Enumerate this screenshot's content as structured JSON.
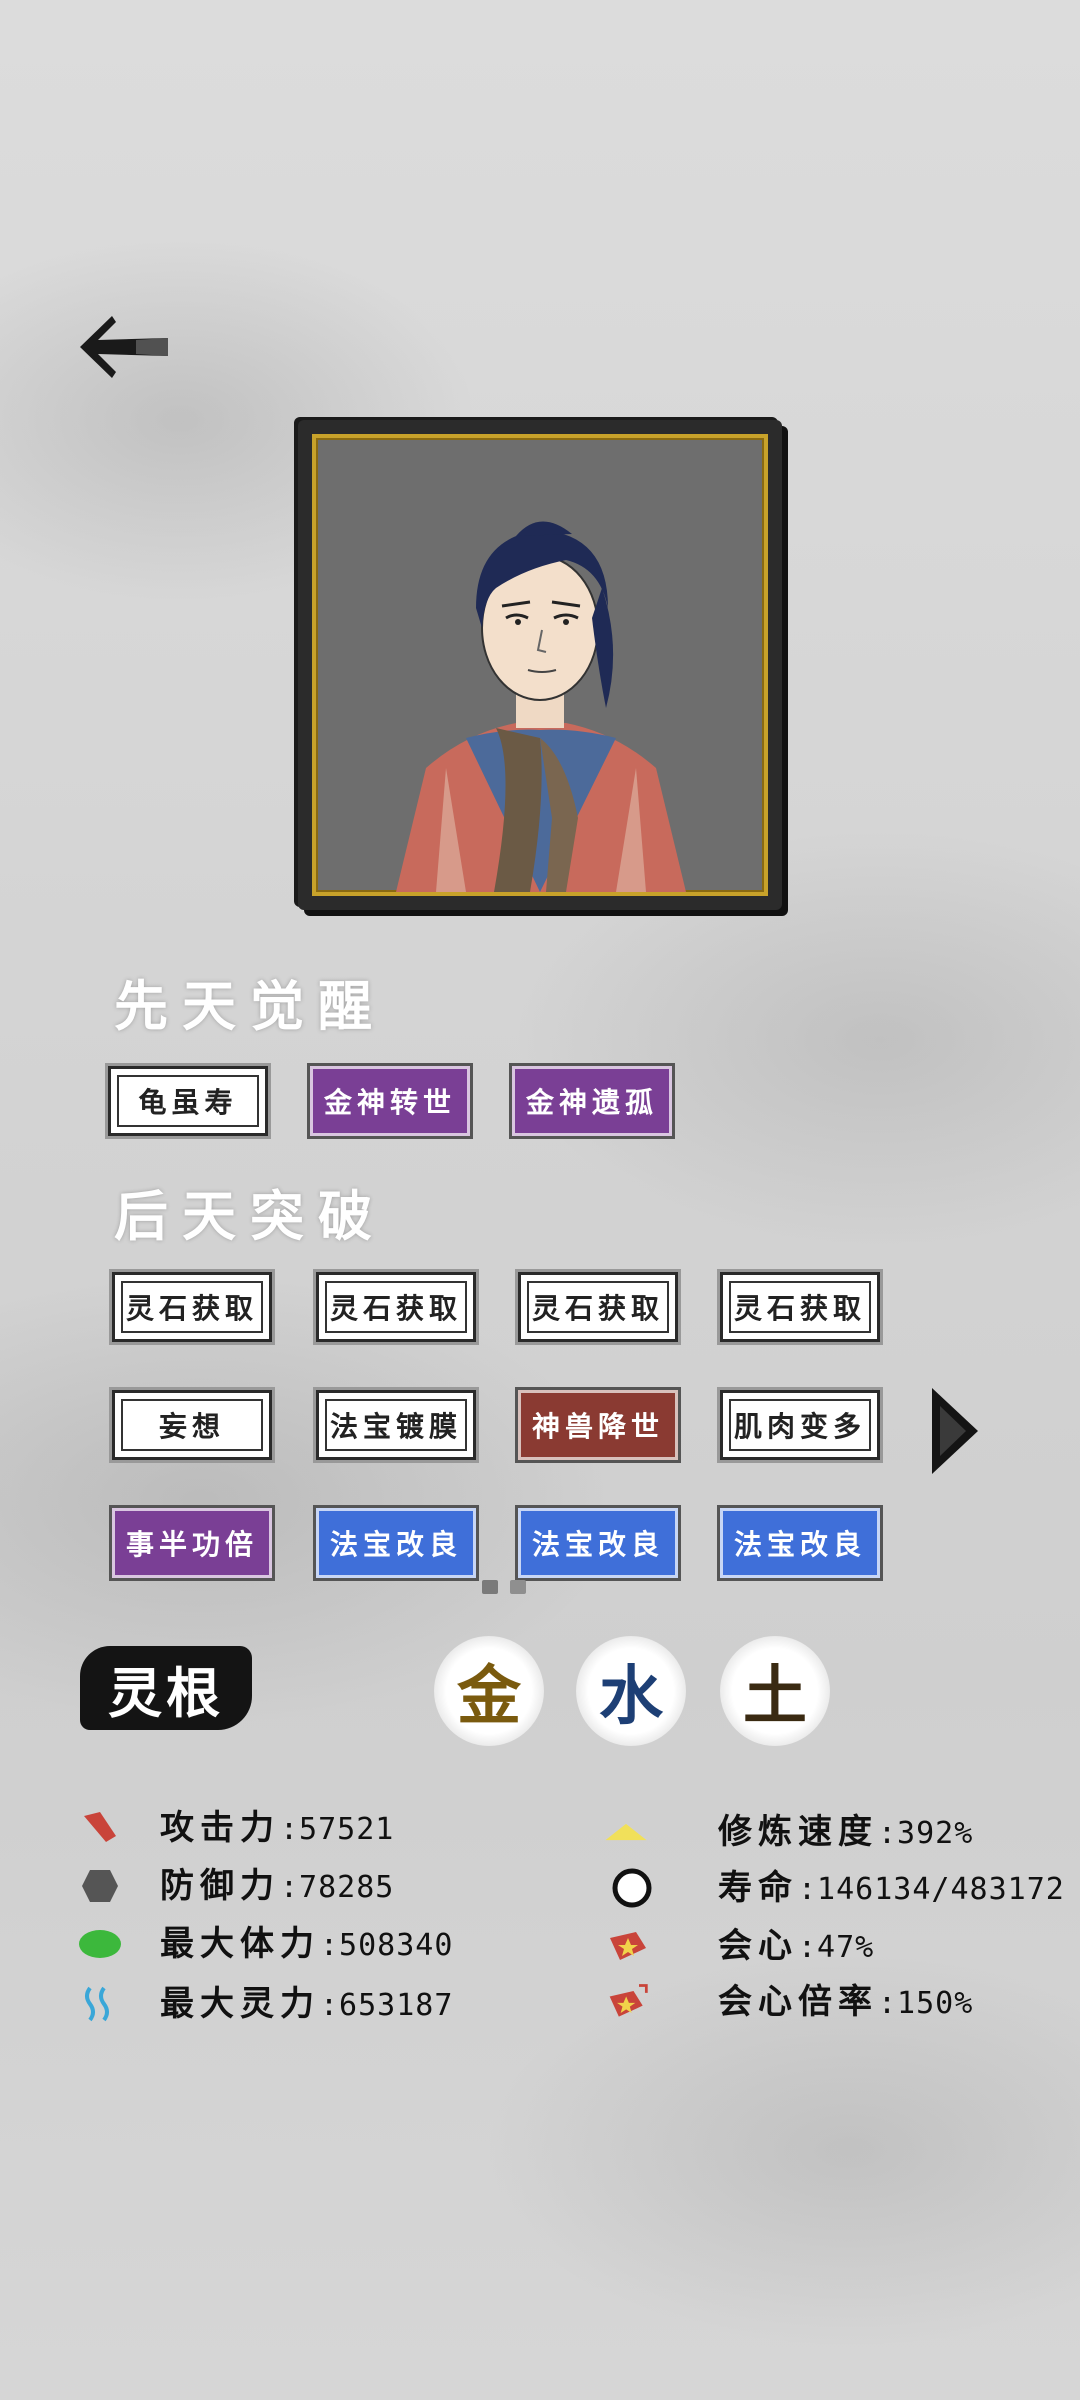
{
  "innate": {
    "title": "先天觉醒",
    "traits": [
      {
        "label": "龟虽寿",
        "tier": "white"
      },
      {
        "label": "金神转世",
        "tier": "purple"
      },
      {
        "label": "金神遗孤",
        "tier": "purple"
      }
    ]
  },
  "acquired": {
    "title": "后天突破",
    "traits": [
      {
        "label": "灵石获取",
        "tier": "white"
      },
      {
        "label": "灵石获取",
        "tier": "white"
      },
      {
        "label": "灵石获取",
        "tier": "white"
      },
      {
        "label": "灵石获取",
        "tier": "white"
      },
      {
        "label": "妄想",
        "tier": "white"
      },
      {
        "label": "法宝镀膜",
        "tier": "white"
      },
      {
        "label": "神兽降世",
        "tier": "red"
      },
      {
        "label": "肌肉变多",
        "tier": "white"
      },
      {
        "label": "事半功倍",
        "tier": "purple"
      },
      {
        "label": "法宝改良",
        "tier": "blue"
      },
      {
        "label": "法宝改良",
        "tier": "blue"
      },
      {
        "label": "法宝改良",
        "tier": "blue"
      }
    ]
  },
  "spirit_root": {
    "label": "灵根",
    "elements": [
      {
        "char": "金",
        "color": "#7a5a0e"
      },
      {
        "char": "水",
        "color": "#1d3f75"
      },
      {
        "char": "土",
        "color": "#3a2a12"
      }
    ]
  },
  "stats": {
    "attack": {
      "label": "攻击力",
      "value": ":57521",
      "icon": "attack-icon"
    },
    "defense": {
      "label": "防御力",
      "value": ":78285",
      "icon": "shield-icon"
    },
    "max_hp": {
      "label": "最大体力",
      "value": ":508340",
      "icon": "health-icon"
    },
    "max_mana": {
      "label": "最大灵力",
      "value": ":653187",
      "icon": "spirit-icon"
    },
    "cultivation_speed": {
      "label": "修炼速度",
      "value": ":392%",
      "icon": "speed-icon"
    },
    "lifespan": {
      "label": "寿命",
      "value": ":146134/483172",
      "icon": "lifespan-icon"
    },
    "crit": {
      "label": "会心",
      "value": ":47%",
      "icon": "crit-icon"
    },
    "crit_multiplier": {
      "label": "会心倍率",
      "value": ":150%",
      "icon": "crit-multiplier-icon"
    }
  },
  "colors": {
    "purple": "#7a3f95",
    "blue": "#3f6fd9",
    "red": "#8a3a32",
    "gold_frame": "#c8a22a"
  }
}
